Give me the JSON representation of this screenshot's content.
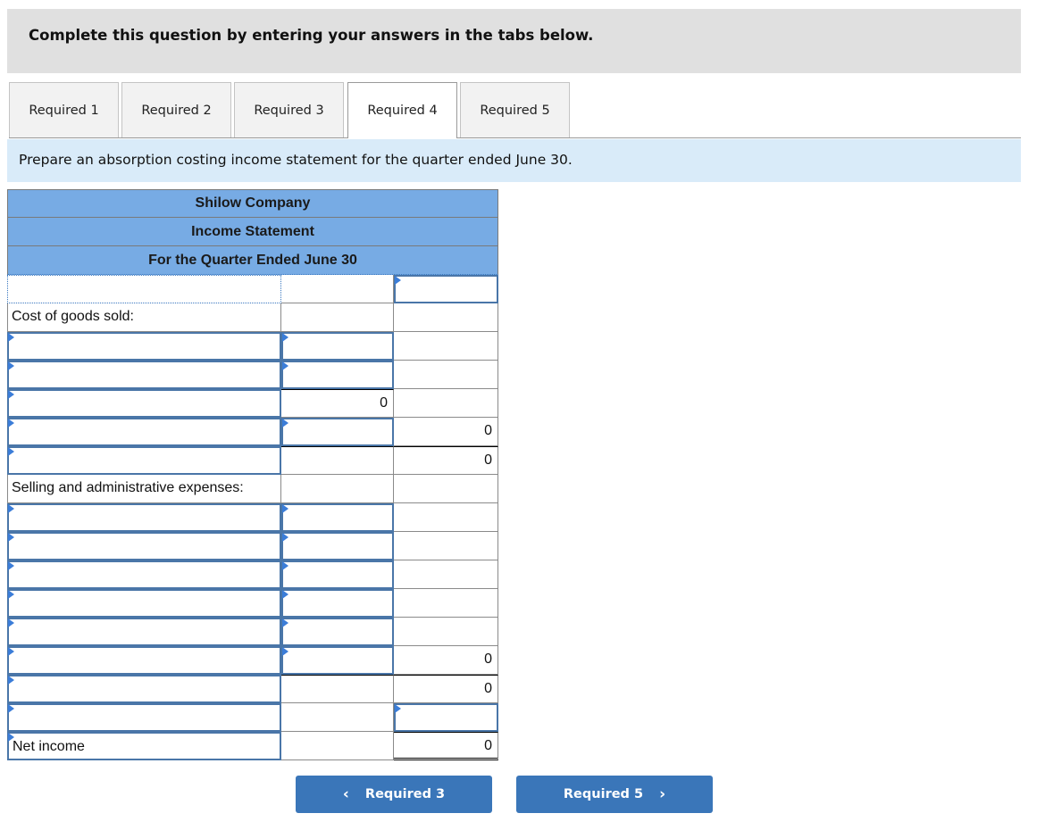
{
  "banner": {
    "text": "Complete this question by entering your answers in the tabs below."
  },
  "tabs": [
    {
      "label": "Required 1",
      "active": false
    },
    {
      "label": "Required 2",
      "active": false
    },
    {
      "label": "Required 3",
      "active": false
    },
    {
      "label": "Required 4",
      "active": true
    },
    {
      "label": "Required 5",
      "active": false
    }
  ],
  "instruction": "Prepare an absorption costing income statement for the quarter ended June 30.",
  "statement": {
    "company": "Shilow Company",
    "title": "Income Statement",
    "period": "For the Quarter Ended June 30",
    "rows": [
      {
        "label": "",
        "col2": "",
        "col3": ""
      },
      {
        "label": "Cost of goods sold:",
        "col2": "",
        "col3": ""
      },
      {
        "label": "",
        "col2": "",
        "col3": ""
      },
      {
        "label": "",
        "col2": "",
        "col3": ""
      },
      {
        "label": "",
        "col2": "0",
        "col3": ""
      },
      {
        "label": "",
        "col2": "",
        "col3": "0"
      },
      {
        "label": "",
        "col2": "",
        "col3": "0"
      },
      {
        "label": "Selling and administrative expenses:",
        "col2": "",
        "col3": ""
      },
      {
        "label": "",
        "col2": "",
        "col3": ""
      },
      {
        "label": "",
        "col2": "",
        "col3": ""
      },
      {
        "label": "",
        "col2": "",
        "col3": ""
      },
      {
        "label": "",
        "col2": "",
        "col3": ""
      },
      {
        "label": "",
        "col2": "",
        "col3": ""
      },
      {
        "label": "",
        "col2": "",
        "col3": "0"
      },
      {
        "label": "",
        "col2": "",
        "col3": "0"
      },
      {
        "label": "",
        "col2": "",
        "col3": ""
      },
      {
        "label": "Net income",
        "col2": "",
        "col3": "0"
      }
    ]
  },
  "nav": {
    "prev_label": "Required 3",
    "next_label": "Required 5",
    "prev_icon": "chevron-left-icon",
    "next_icon": "chevron-right-icon"
  }
}
